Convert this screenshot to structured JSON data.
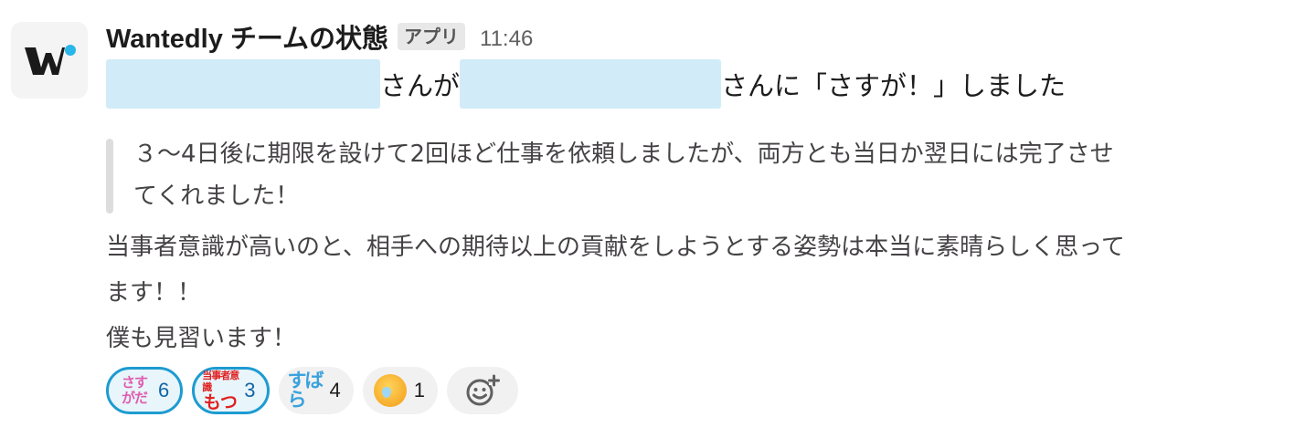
{
  "message": {
    "sender": "Wantedly チームの状態",
    "app_badge": "アプリ",
    "timestamp": "11:46",
    "line1": {
      "text_after_first": "さんが",
      "text_after_second": "さんに「さすが！」しました"
    },
    "quote_lines": [
      "３〜4日後に期限を設けて2回ほど仕事を依頼しましたが、両方とも当日か翌日には完了させ",
      "てくれました！"
    ],
    "body_lines": [
      "当事者意識が高いのと、相手への期待以上の貢献をしようとする姿勢は本当に素晴らしく思って",
      "ます！！",
      "僕も見習います！"
    ]
  },
  "reactions": [
    {
      "emoji_name": "sasuga-dana-icon",
      "emoji_lines": [
        "さす",
        "がだ"
      ],
      "count": "6",
      "active": true
    },
    {
      "emoji_name": "motsu-icon",
      "emoji_lines": [
        "当事者意識",
        "もつ"
      ],
      "count": "3",
      "active": true
    },
    {
      "emoji_name": "subara-icon",
      "emoji_text": "すばら",
      "count": "4",
      "active": false
    },
    {
      "emoji_name": "sweat-smile-icon",
      "count": "1",
      "active": false
    }
  ],
  "colors": {
    "active_border": "#1d9bd1",
    "active_bg": "#e8f5fa",
    "redaction": "#d1ebf8",
    "quote_bar": "#dddddd",
    "brand_dot": "#29b6e8"
  }
}
